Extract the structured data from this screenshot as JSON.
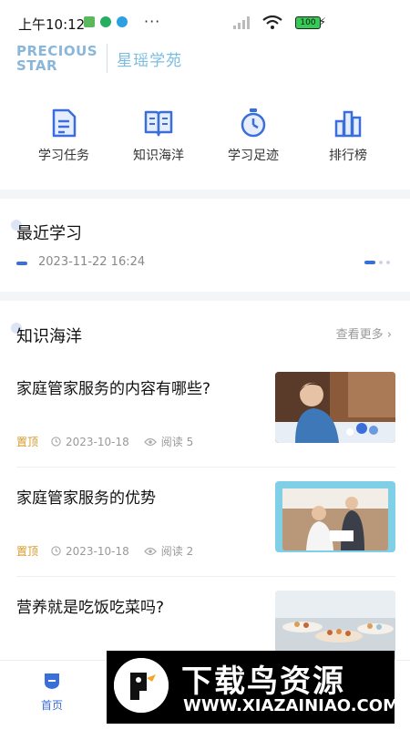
{
  "status_bar": {
    "time": "上午10:12",
    "more": "···",
    "battery": "100"
  },
  "brand": {
    "en_line1": "PRECIOUS",
    "en_line2": "STAR",
    "cn": "星瑶学苑"
  },
  "quick_nav": [
    {
      "label": "学习任务",
      "icon": "task-document-icon"
    },
    {
      "label": "知识海洋",
      "icon": "open-book-icon"
    },
    {
      "label": "学习足迹",
      "icon": "stopwatch-icon"
    },
    {
      "label": "排行榜",
      "icon": "ranking-bars-icon"
    }
  ],
  "recent": {
    "title": "最近学习",
    "date": "2023-11-22 16:24"
  },
  "knowledge": {
    "title": "知识海洋",
    "more": "查看更多",
    "articles": [
      {
        "title": "家庭管家服务的内容有哪些?",
        "tag": "置顶",
        "date": "2023-10-18",
        "reads": "阅读 5"
      },
      {
        "title": "家庭管家服务的优势",
        "tag": "置顶",
        "date": "2023-10-18",
        "reads": "阅读 2"
      },
      {
        "title": "营养就是吃饭吃菜吗?"
      }
    ]
  },
  "tabbar": {
    "home": "首页"
  },
  "watermark": {
    "title": "下载鸟资源",
    "url": "WWW.XIAZAINIAO.COM"
  },
  "colors": {
    "accent": "#3a6ed8",
    "pin": "#d69b2a",
    "brand": "#7bbde0"
  }
}
